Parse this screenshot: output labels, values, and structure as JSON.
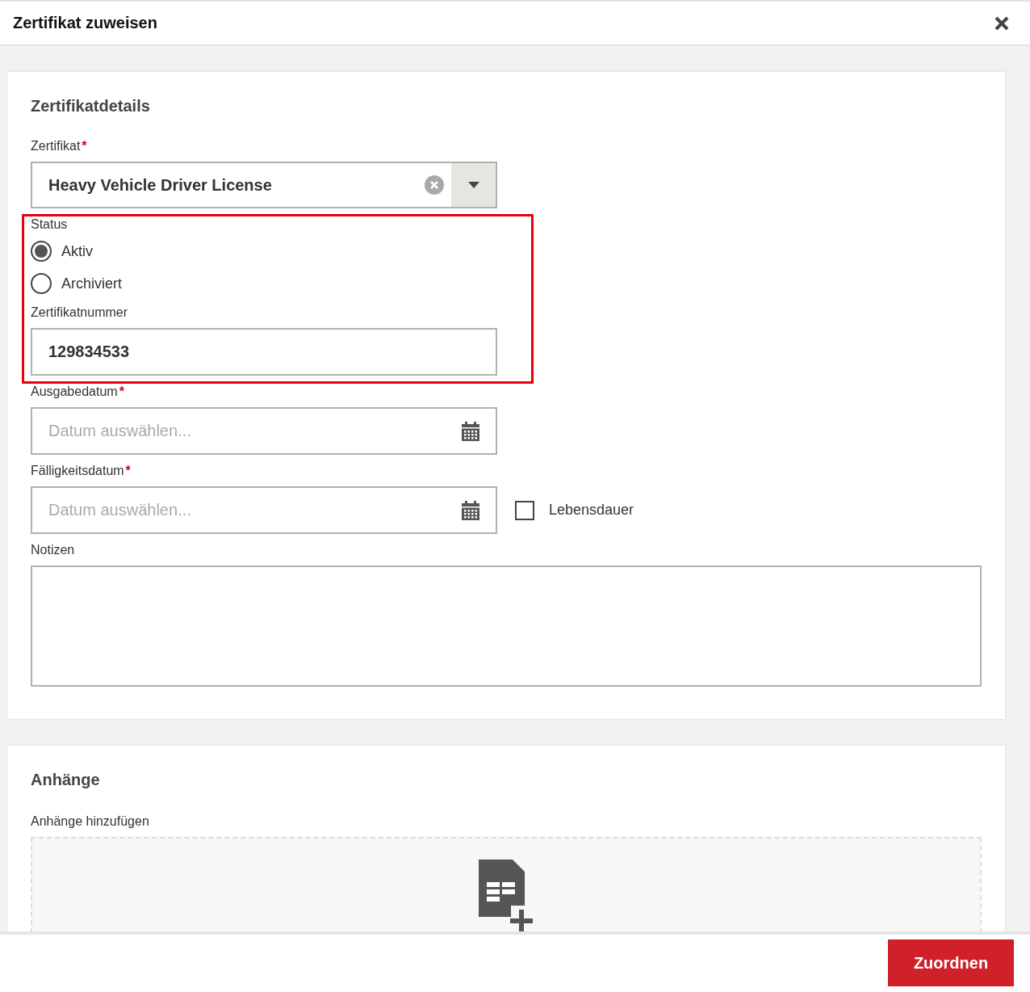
{
  "dialog": {
    "title": "Zertifikat zuweisen"
  },
  "details": {
    "heading": "Zertifikatdetails",
    "certificate": {
      "label": "Zertifikat",
      "required_mark": "*",
      "value": "Heavy Vehicle Driver License"
    },
    "status": {
      "label": "Status",
      "options": [
        {
          "label": "Aktiv",
          "selected": true
        },
        {
          "label": "Archiviert",
          "selected": false
        }
      ]
    },
    "number": {
      "label": "Zertifikatnummer",
      "value": "129834533"
    },
    "issue_date": {
      "label": "Ausgabedatum",
      "required_mark": "*",
      "placeholder": "Datum auswählen..."
    },
    "due_date": {
      "label": "Fälligkeitsdatum",
      "required_mark": "*",
      "placeholder": "Datum auswählen...",
      "lifetime": {
        "label": "Lebensdauer",
        "checked": false
      }
    },
    "notes": {
      "label": "Notizen"
    }
  },
  "attachments": {
    "heading": "Anhänge",
    "label": "Anhänge hinzufügen"
  },
  "footer": {
    "submit": "Zuordnen"
  }
}
